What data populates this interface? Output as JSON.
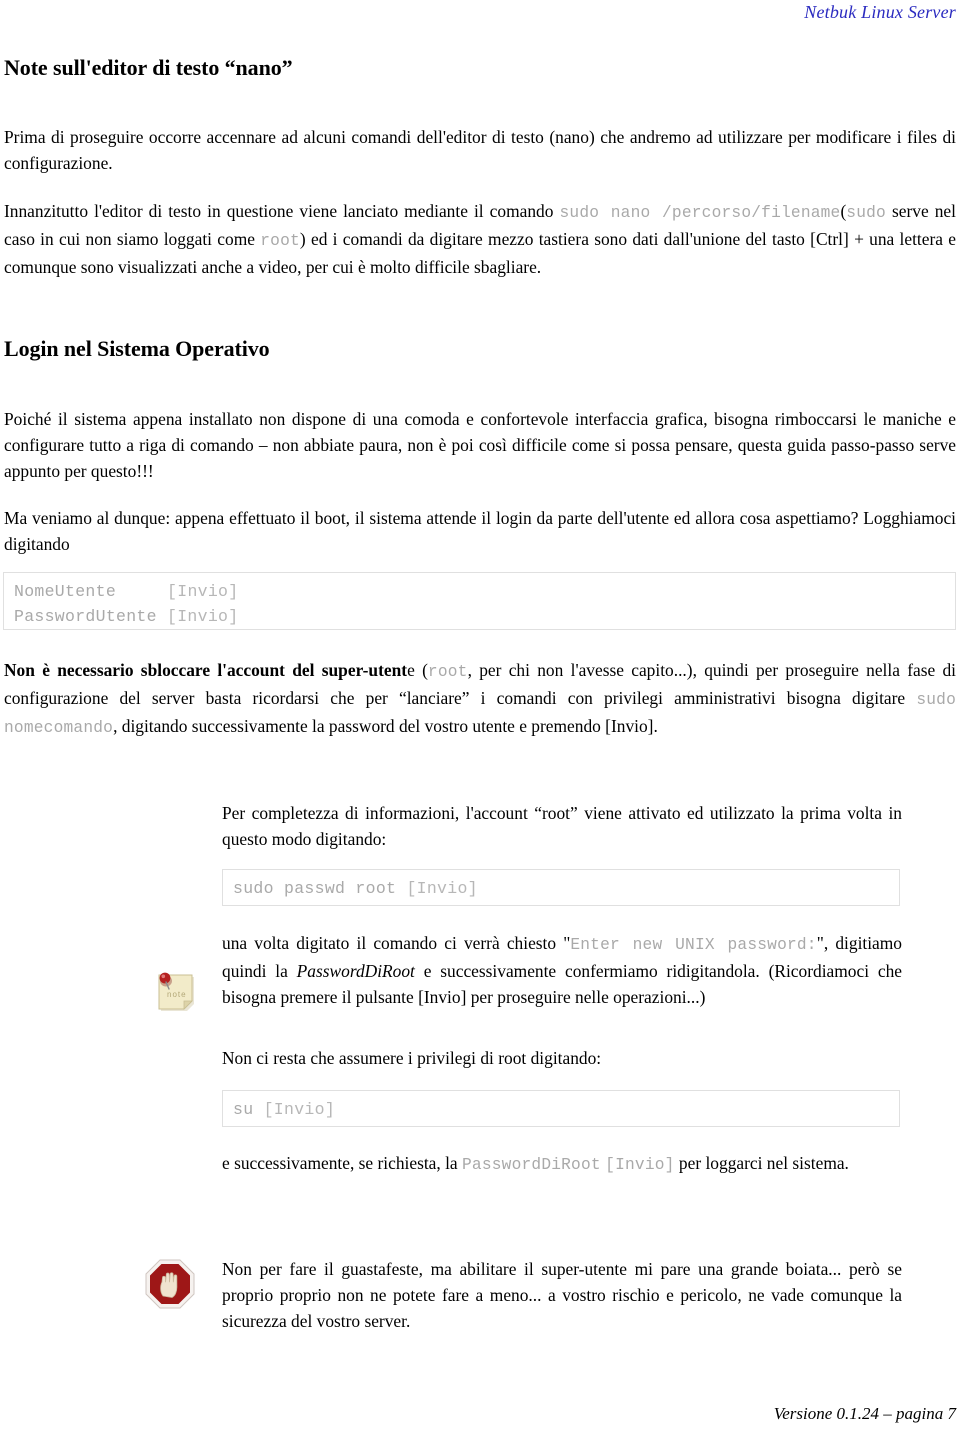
{
  "header": {
    "running_title": "Netbuk Linux Server",
    "color": "#2b2bc0"
  },
  "sections": {
    "nano": {
      "heading": "Note sull'editor di testo “nano”",
      "intro": "Prima di proseguire occorre accennare ad alcuni comandi dell'editor di testo (nano) che andremo ad utilizzare per modificare i files di configurazione.",
      "p2_a": "Innanzitutto l'editor di testo in questione viene lanciato mediante il comando ",
      "p2_code1": "sudo nano /percorso/filename",
      "p2_b": "(",
      "p2_code2": "sudo",
      "p2_c": " serve nel caso in cui non siamo loggati come ",
      "p2_code3": "root",
      "p2_d": ") ed i comandi da digitare mezzo tastiera sono dati dall'unione del tasto [Ctrl] + una lettera e comunque sono visualizzati anche a video, per cui è molto difficile sbagliare."
    },
    "login": {
      "heading": "Login nel Sistema Operativo",
      "p1": "Poiché il sistema appena installato non dispone di una comoda e confortevole interfaccia grafica, bisogna rimboccarsi le maniche e configurare tutto a riga di comando – non abbiate paura, non è poi così difficile come si possa pensare, questa guida passo-passo serve appunto per questo!!!",
      "p2": "Ma veniamo al dunque: appena effettuato il boot, il sistema attende il login da parte dell'utente ed allora cosa aspettiamo? Logghiamoci digitando",
      "code_block": "NomeUtente     [Invio]\nPasswordUtente [Invio]",
      "code_line1_cmd": "NomeUtente",
      "code_line1_key": "[Invio]",
      "code_line2_cmd": "PasswordUtente",
      "code_line2_key": "[Invio]",
      "p3_bold": "Non è necessario sbloccare l'account del super-utent",
      "p3_a": "e (",
      "p3_code1": "root",
      "p3_b": ", per chi non l'avesse capito...), quindi per proseguire nella fase di configurazione del server basta ricordarsi che per “lanciare” i comandi con privilegi amministrativi bisogna digitare ",
      "p3_code2": "sudo nomecomando",
      "p3_c": ", digitando successivamente la password del vostro utente e premendo [Invio]."
    },
    "root_note": {
      "p1": "Per completezza di informazioni, l'account “root” viene attivato ed utilizzato la prima volta in questo modo digitando:",
      "code_passwd": "sudo passwd root [Invio]",
      "code_passwd_cmd": "sudo passwd root",
      "code_passwd_key": "[Invio]",
      "p2_a": "una volta digitato il comando ci verrà chiesto \"",
      "p2_code": "Enter new UNIX password:",
      "p2_b": "\", digitiamo quindi la ",
      "p2_em": "PasswordDiRoot",
      "p2_c": " e successivamente confermiamo ridigitandola. (Ricordiamoci che bisogna premere il pulsante [Invio] per proseguire nelle operazioni...)",
      "p3": "Non ci resta che assumere i privilegi di root digitando:",
      "code_su": "su [Invio]",
      "code_su_cmd": "su",
      "code_su_key": "[Invio]",
      "p4_a": "e successivamente, se richiesta, la ",
      "p4_code1": "PasswordDiRoot",
      "p4_code2": "[Invio]",
      "p4_b": " per loggarci nel sistema."
    },
    "warning": {
      "text": "Non per fare il guastafeste, ma abilitare il super-utente mi pare una grande boiata... però se proprio proprio non ne potete fare a meno... a vostro rischio e pericolo, ne vade comunque la sicurezza del vostro server."
    }
  },
  "icons": {
    "note": "sticky-note-icon",
    "note_label": "note",
    "stop": "stop-hand-icon"
  },
  "footer": {
    "text": "Versione 0.1.24 – pagina 7"
  }
}
